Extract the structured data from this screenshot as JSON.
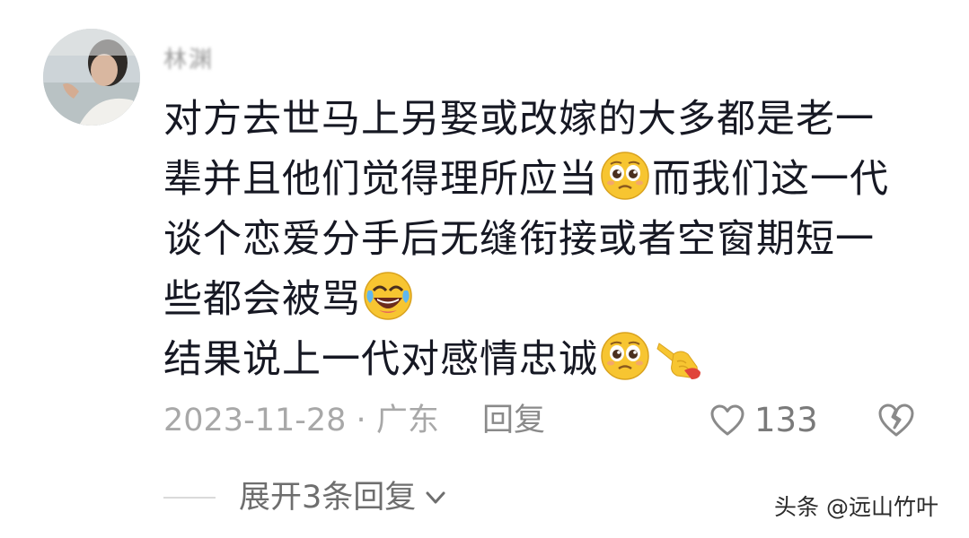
{
  "comment": {
    "username": "林渊",
    "avatar_icon": "user-avatar-photo",
    "lines": [
      {
        "text": "对方去世马上另娶或改嫁的大多都是老一"
      },
      {
        "text_a": "辈并且他们觉得理所应当",
        "emoji_a": "pleading-face-icon",
        "text_b": "而我们这一代"
      },
      {
        "text": "谈个恋爱分手后无缝衔接或者空窗期短一"
      },
      {
        "text_a": "些都会被骂",
        "emoji_a": "tears-of-joy-icon"
      },
      {
        "text_a": "结果说上一代对感情忠诚",
        "emoji_a": "pleading-face-icon",
        "emoji_b": "pointing-finger-icon"
      }
    ],
    "meta": {
      "date": "2023-11-28",
      "separator": "·",
      "location": "广东"
    },
    "reply_label": "回复",
    "likes": {
      "icon": "heart-outline-icon",
      "count": "133"
    },
    "dislike_icon": "broken-heart-icon",
    "expand_replies_label": "展开3条回复",
    "expand_icon": "chevron-down-icon"
  },
  "watermark": {
    "text": "头条 @远山竹叶"
  },
  "colors": {
    "text_primary": "#161823",
    "text_meta": "#a8a8a8",
    "emoji_yellow": "#f7c531",
    "hand_red": "#e0443a"
  }
}
